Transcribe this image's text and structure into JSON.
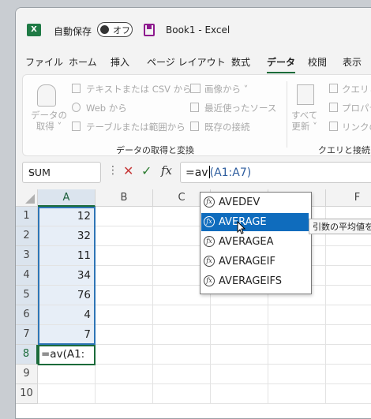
{
  "titlebar": {
    "app_icon": "excel-icon",
    "autosave_label": "自動保存",
    "toggle_state": "オフ",
    "save_icon": "save-icon",
    "book_title": "Book1  -  Excel"
  },
  "ribbon_tabs": [
    "ファイル",
    "ホーム",
    "挿入",
    "ページ レイアウト",
    "数式",
    "データ",
    "校閲",
    "表示"
  ],
  "active_tab": "データ",
  "ribbon": {
    "get_data_label": "データの\n取得 ˅",
    "from_text_csv": "テキストまたは CSV から",
    "from_web": "Web から",
    "from_table": "テーブルまたは範囲から",
    "from_image": "画像から ˅",
    "recent_sources": "最近使ったソース",
    "existing_connections": "既存の接続",
    "group_get_transform": "データの取得と変換",
    "refresh_all": "すべて\n更新 ˅",
    "queries_connections": "クエリと接",
    "properties": "プロパティ",
    "edit_links": "リンクの編",
    "group_queries": "クエリと接続"
  },
  "formula_bar": {
    "name_box": "SUM",
    "dots": "⋮",
    "cancel_icon": "✕",
    "enter_icon": "✓",
    "fx_label": "fx",
    "formula_prefix": "=av",
    "formula_suffix": "(A1:A7)"
  },
  "grid": {
    "columns": [
      "A",
      "B",
      "C",
      "D",
      "E",
      "F"
    ],
    "rows": [
      "1",
      "2",
      "3",
      "4",
      "5",
      "6",
      "7",
      "8",
      "9",
      "10"
    ],
    "column_a_values": [
      "12",
      "32",
      "11",
      "34",
      "76",
      "4",
      "7"
    ],
    "active_cell_text": "=av(A1:"
  },
  "autocomplete": {
    "items": [
      "AVEDEV",
      "AVERAGE",
      "AVERAGEA",
      "AVERAGEIF",
      "AVERAGEIFS"
    ],
    "selected": "AVERAGE",
    "tooltip": "引数の平均値を返"
  },
  "colors": {
    "excel_green": "#1b6b3a",
    "selection_blue": "#0f6cbd",
    "range_border": "#2e75b6"
  }
}
